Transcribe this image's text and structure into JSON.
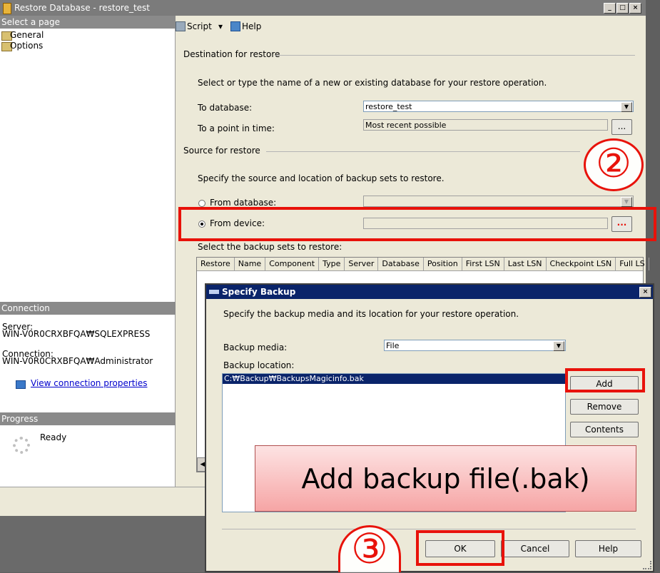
{
  "window": {
    "title": "Restore Database - restore_test",
    "controls": [
      "_",
      "□",
      "×"
    ]
  },
  "left": {
    "select_page_header": "Select a page",
    "pages": [
      "General",
      "Options"
    ],
    "connection_header": "Connection",
    "server_label": "Server:",
    "server_value": "WIN-V0R0CRXBFQA₩SQLEXPRESS",
    "connection_label": "Connection:",
    "connection_value": "WIN-V0R0CRXBFQA₩Administrator",
    "view_props_link": "View connection properties",
    "progress_header": "Progress",
    "progress_status": "Ready"
  },
  "toolbar": {
    "script_label": "Script",
    "script_arrow": "▾",
    "help_label": "Help"
  },
  "destination": {
    "section_label": "Destination for restore",
    "instruction": "Select or type the name of a new or existing database for your restore operation.",
    "to_database_label": "To database:",
    "to_database_value": "restore_test",
    "point_in_time_label": "To a point in time:",
    "point_in_time_value": "Most recent possible",
    "browse_label": "..."
  },
  "source": {
    "section_label": "Source for restore",
    "instruction": "Specify the source and location of backup sets to restore.",
    "from_database_label": "From database:",
    "from_device_label": "From device:",
    "device_browse_label": "..."
  },
  "backup_sets": {
    "label": "Select the backup sets to restore:",
    "columns": [
      "Restore",
      "Name",
      "Component",
      "Type",
      "Server",
      "Database",
      "Position",
      "First LSN",
      "Last LSN",
      "Checkpoint LSN",
      "Full LS"
    ]
  },
  "dialog": {
    "title": "Specify Backup",
    "instruction": "Specify the backup media and its location for your restore operation.",
    "media_label": "Backup media:",
    "media_value": "File",
    "location_label": "Backup location:",
    "location_items": [
      "C:₩Backup₩BackupsMagicinfo.bak"
    ],
    "add_label": "Add",
    "remove_label": "Remove",
    "contents_label": "Contents",
    "ok_label": "OK",
    "cancel_label": "Cancel",
    "help_label": "Help"
  },
  "annotations": {
    "step2": "②",
    "step3": "③",
    "callout": "Add backup file(.bak)",
    "highlight_color": "#e8120a"
  }
}
